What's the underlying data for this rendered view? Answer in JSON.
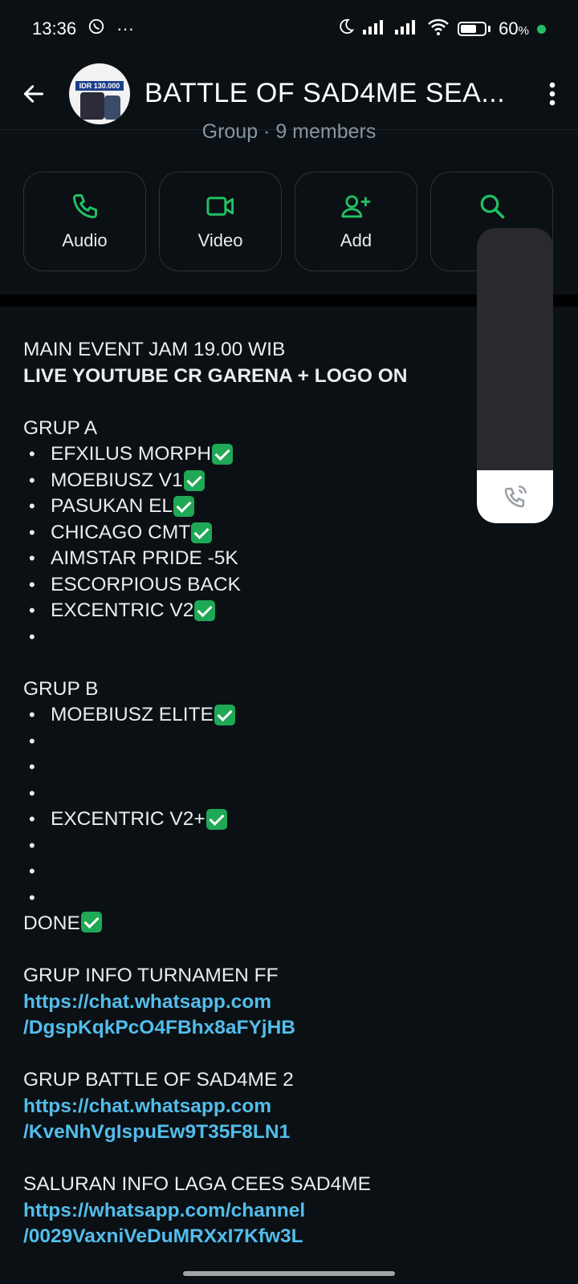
{
  "status_bar": {
    "time": "13:36",
    "more": "···",
    "battery": "60",
    "battery_unit": "%"
  },
  "header": {
    "title": "BATTLE OF SAD4ME SEA...",
    "avatar_banner": "IDR 130.000"
  },
  "subtitle": "Group · 9 members",
  "actions": {
    "audio": "Audio",
    "video": "Video",
    "add": "Add",
    "search": "Se"
  },
  "description": {
    "line1": "MAIN EVENT JAM 19.00 WIB",
    "line2": "LIVE YOUTUBE CR GARENA + LOGO ON",
    "grup_a": "GRUP A",
    "a1": "EFXILUS MORPH",
    "a2": "MOEBIUSZ V1",
    "a3": "PASUKAN EL",
    "a4": "CHICAGO CMT",
    "a5": "AIMSTAR PRIDE -5K",
    "a6": "ESCORPIOUS BACK",
    "a7": "EXCENTRIC V2",
    "grup_b": "GRUP B",
    "b1": "MOEBIUSZ ELITE",
    "b5": "EXCENTRIC V2+",
    "done": "DONE",
    "info1_title": "GRUP INFO TURNAMEN FF",
    "info1_link1": "https://chat.whatsapp.com",
    "info1_link2": "/DgspKqkPcO4FBhx8aFYjHB",
    "info2_title": "GRUP BATTLE OF SAD4ME 2",
    "info2_link1": "https://chat.whatsapp.com",
    "info2_link2": "/KveNhVgIspuEw9T35F8LN1",
    "info3_title": "SALURAN INFO LAGA CEES SAD4ME",
    "info3_link1": "https://whatsapp.com/channel",
    "info3_link2": "/0029VaxniVeDuMRXxI7Kfw3L"
  },
  "colors": {
    "accent": "#21c063",
    "link": "#53bdeb",
    "background": "#0b1014"
  }
}
